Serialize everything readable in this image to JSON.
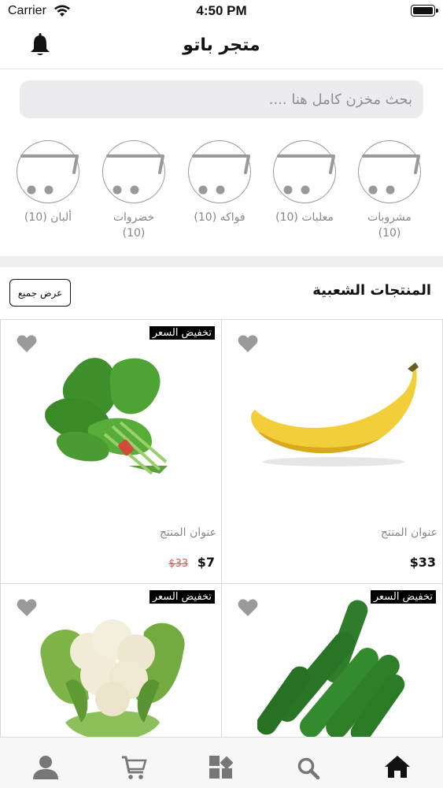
{
  "status_bar": {
    "carrier": "Carrier",
    "time": "4:50 PM"
  },
  "header": {
    "title": "متجر باتو",
    "bell_icon": "bell-icon"
  },
  "search": {
    "placeholder": "بحث مخزن كامل هنا ...."
  },
  "categories": [
    {
      "label": "مشروبات",
      "count": "(10)",
      "icon": "cart-icon"
    },
    {
      "label": "معلبات",
      "count": "(10)",
      "icon": "cart-icon"
    },
    {
      "label": "فواكه",
      "count": "(10)",
      "icon": "cart-icon"
    },
    {
      "label": "خضروات",
      "count": "(10)",
      "icon": "cart-icon"
    },
    {
      "label": "ألبان",
      "count": "(10)",
      "icon": "cart-icon"
    }
  ],
  "popular": {
    "title": "المنتجات الشعبية",
    "view_all": "عرض جميع"
  },
  "products": [
    {
      "badge": "",
      "title": "عنوان المنتج",
      "price": "$33",
      "old_price": "",
      "image": "banana"
    },
    {
      "badge": "تخفيض السعر",
      "title": "عنوان المنتج",
      "price": "$7",
      "old_price": "$33",
      "image": "spinach"
    },
    {
      "badge": "تخفيض السعر",
      "title": "",
      "price": "",
      "old_price": "",
      "image": "cucumbers"
    },
    {
      "badge": "تخفيض السعر",
      "title": "",
      "price": "",
      "old_price": "",
      "image": "cauliflower"
    }
  ],
  "tab_bar": {
    "tabs": [
      "home-icon",
      "search-icon",
      "grid-icon",
      "cart-icon",
      "profile-icon"
    ]
  },
  "colors": {
    "accent": "#000000",
    "sale_price": "#e05656",
    "muted_text": "#888888",
    "search_bg": "#ececef",
    "badge_bg": "#000000",
    "divider": "#efefef"
  }
}
